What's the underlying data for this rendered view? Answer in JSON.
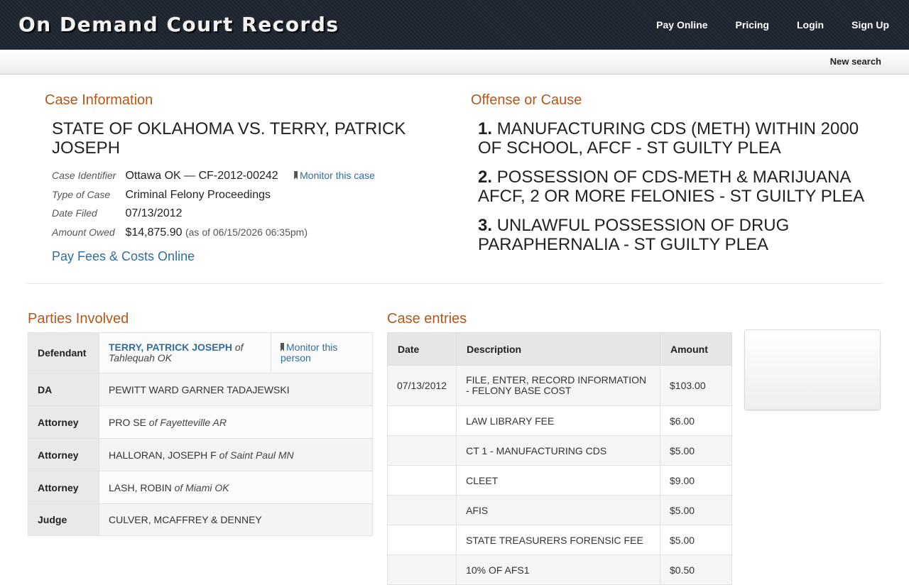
{
  "header": {
    "brand": "On Demand Court Records",
    "nav": [
      "Pay Online",
      "Pricing",
      "Login",
      "Sign Up"
    ],
    "new_search": "New search"
  },
  "case_info": {
    "heading": "Case Information",
    "title": "STATE OF OKLAHOMA VS. TERRY, PATRICK JOSEPH",
    "identifier_label": "Case Identifier",
    "identifier": "Ottawa OK — CF-2012-00242",
    "monitor_case": "Monitor this case",
    "type_label": "Type of Case",
    "type": "Criminal Felony Proceedings",
    "filed_label": "Date Filed",
    "filed": "07/13/2012",
    "owed_label": "Amount Owed",
    "owed": "$14,875.90",
    "owed_asof": "(as of 06/15/2026 06:35pm)",
    "pay_link": "Pay Fees & Costs Online"
  },
  "offense": {
    "heading": "Offense or Cause",
    "items": [
      {
        "num": "1.",
        "text": "MANUFACTURING CDS (METH) WITHIN 2000 OF SCHOOL, AFCF - ST GUILTY PLEA"
      },
      {
        "num": "2.",
        "text": "POSSESSION OF CDS-METH & MARIJUANA AFCF, 2 OR MORE FELONIES - ST GUILTY PLEA"
      },
      {
        "num": "3.",
        "text": "UNLAWFUL POSSESSION OF DRUG PARAPHERNALIA - ST GUILTY PLEA"
      }
    ]
  },
  "parties": {
    "heading": "Parties Involved",
    "defendant_label": "Defendant",
    "defendant_name": "TERRY, PATRICK JOSEPH",
    "defendant_of": "of",
    "defendant_loc": "Tahlequah OK",
    "monitor_person": "Monitor this person",
    "rows": [
      {
        "role": "DA",
        "name": "PEWITT WARD GARNER TADAJEWSKI",
        "loc": ""
      },
      {
        "role": "Attorney",
        "name": "PRO SE",
        "loc": "of Fayetteville AR"
      },
      {
        "role": "Attorney",
        "name": "HALLORAN, JOSEPH F",
        "loc": "of Saint Paul MN"
      },
      {
        "role": "Attorney",
        "name": "LASH, ROBIN",
        "loc": "of Miami OK"
      },
      {
        "role": "Judge",
        "name": "CULVER, MCAFFREY & DENNEY",
        "loc": ""
      }
    ]
  },
  "entries": {
    "heading": "Case entries",
    "columns": [
      "Date",
      "Description",
      "Amount"
    ],
    "rows": [
      {
        "date": "07/13/2012",
        "desc": "FILE, ENTER, RECORD INFORMATION - FELONY BASE COST",
        "amt": "$103.00"
      },
      {
        "date": "",
        "desc": "LAW LIBRARY FEE",
        "amt": "$6.00"
      },
      {
        "date": "",
        "desc": "CT 1 - MANUFACTURING CDS",
        "amt": "$5.00"
      },
      {
        "date": "",
        "desc": "CLEET",
        "amt": "$9.00"
      },
      {
        "date": "",
        "desc": "AFIS",
        "amt": "$5.00"
      },
      {
        "date": "",
        "desc": "STATE TREASURERS FORENSIC FEE",
        "amt": "$5.00"
      },
      {
        "date": "",
        "desc": "10% OF AFS1",
        "amt": "$0.50"
      }
    ]
  }
}
